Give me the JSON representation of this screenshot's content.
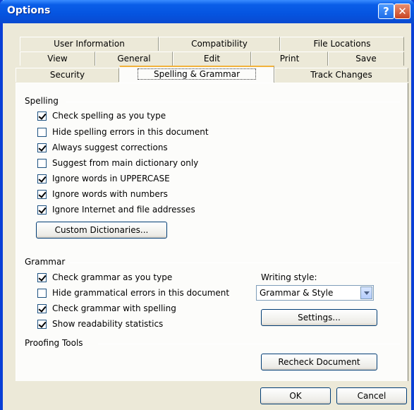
{
  "title": "Options",
  "help_label": "?",
  "close_label": "✕",
  "tabs": {
    "row1": [
      "User Information",
      "Compatibility",
      "File Locations"
    ],
    "row2": [
      "View",
      "General",
      "Edit",
      "Print",
      "Save"
    ],
    "row3": [
      "Security",
      "Spelling & Grammar",
      "Track Changes"
    ],
    "selected": "Spelling & Grammar"
  },
  "spelling": {
    "heading": "Spelling",
    "options": [
      {
        "label": "Check spelling as you type",
        "checked": true
      },
      {
        "label": "Hide spelling errors in this document",
        "checked": false
      },
      {
        "label": "Always suggest corrections",
        "checked": true
      },
      {
        "label": "Suggest from main dictionary only",
        "checked": false
      },
      {
        "label": "Ignore words in UPPERCASE",
        "checked": true
      },
      {
        "label": "Ignore words with numbers",
        "checked": true
      },
      {
        "label": "Ignore Internet and file addresses",
        "checked": true
      }
    ],
    "custom_dictionaries_label": "Custom Dictionaries..."
  },
  "grammar": {
    "heading": "Grammar",
    "options": [
      {
        "label": "Check grammar as you type",
        "checked": true
      },
      {
        "label": "Hide grammatical errors in this document",
        "checked": false
      },
      {
        "label": "Check grammar with spelling",
        "checked": true
      },
      {
        "label": "Show readability statistics",
        "checked": true
      }
    ],
    "writing_style_label": "Writing style:",
    "writing_style_value": "Grammar & Style",
    "settings_label": "Settings..."
  },
  "proofing": {
    "heading": "Proofing Tools",
    "recheck_label": "Recheck Document"
  },
  "footer": {
    "ok_label": "OK",
    "cancel_label": "Cancel"
  }
}
